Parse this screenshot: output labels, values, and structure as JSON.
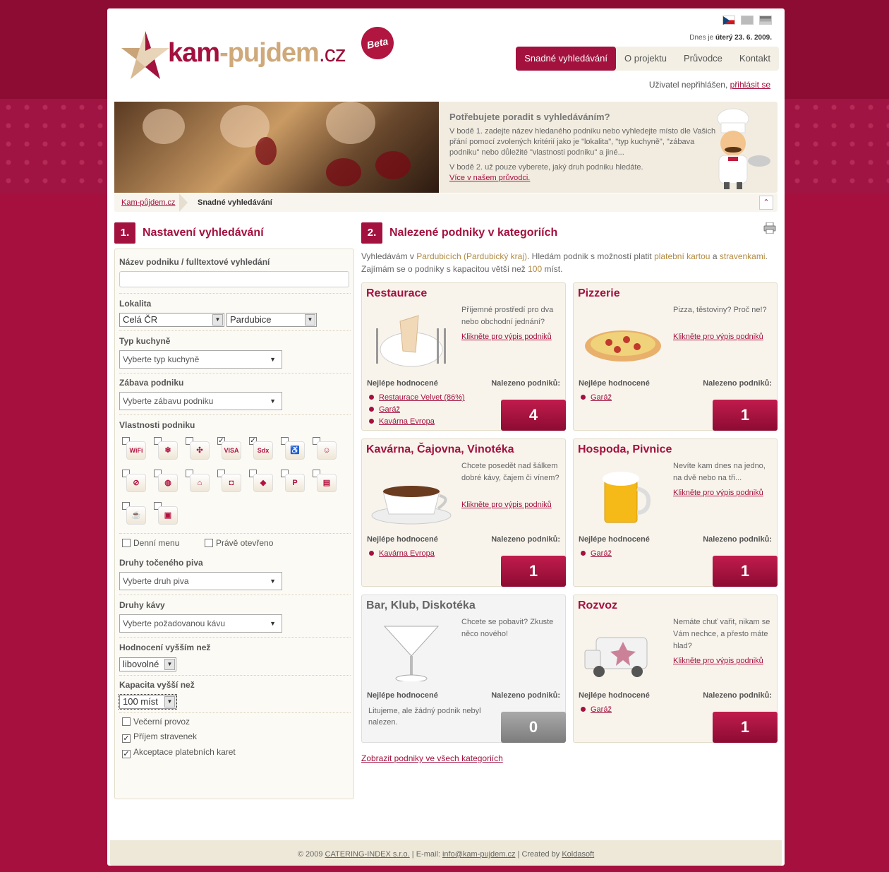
{
  "flags": [
    "cz-flag-icon",
    "en-flag-icon",
    "de-flag-icon"
  ],
  "header": {
    "logo_kam": "kam",
    "logo_dash": "-",
    "logo_pujdem": "pujdem",
    "logo_tld": ".cz",
    "beta": "Beta",
    "date_prefix": "Dnes je",
    "date_value": "úterý 23. 6. 2009."
  },
  "nav": [
    "Snadné vyhledávání",
    "O projektu",
    "Průvodce",
    "Kontakt"
  ],
  "login": {
    "text": "Uživatel nepřihlášen,",
    "link": "přihlásit se"
  },
  "banner": {
    "title": "Potřebujete poradit s vyhledáváním?",
    "p1": "V bodě 1. zadejte název hledaného podniku nebo vyhledejte místo dle Vašich přání pomocí zvolených kritérií jako je \"lokalita\", \"typ kuchyně\", \"zábava podniku\" nebo důležité \"vlastnosti podniku\" a jiné...",
    "p2": "V bodě 2. už pouze vyberete, jaký druh podniku hledáte.",
    "link": "Více v našem průvodci."
  },
  "breadcrumb": [
    "Kam-půjdem.cz",
    "Snadné vyhledávání"
  ],
  "left": {
    "num": "1.",
    "title": "Nastavení vyhledávání",
    "name_label": "Název podniku / fulltextové vyhledání",
    "location_label": "Lokalita",
    "location_region": "Celá ČR",
    "location_city": "Pardubice",
    "cuisine_label": "Typ kuchyně",
    "cuisine_value": "Vyberte typ kuchyně",
    "fun_label": "Zábava podniku",
    "fun_value": "Vyberte zábavu podniku",
    "props_label": "Vlastnosti podniku",
    "props": [
      {
        "icon": "wifi-icon",
        "checked": false,
        "glyph": "WiFi"
      },
      {
        "icon": "air-conditioning-icon",
        "checked": false,
        "glyph": "❄"
      },
      {
        "icon": "fan-icon",
        "checked": false,
        "glyph": "✣"
      },
      {
        "icon": "visa-card-icon",
        "checked": true,
        "glyph": "VISA"
      },
      {
        "icon": "sodexo-voucher-icon",
        "checked": true,
        "glyph": "Sdx"
      },
      {
        "icon": "wheelchair-icon",
        "checked": false,
        "glyph": "♿"
      },
      {
        "icon": "baby-icon",
        "checked": false,
        "glyph": "☺"
      },
      {
        "icon": "no-smoking-icon",
        "checked": false,
        "glyph": "⊘"
      },
      {
        "icon": "smoking-area-icon",
        "checked": false,
        "glyph": "◍"
      },
      {
        "icon": "terrace-icon",
        "checked": false,
        "glyph": "⌂"
      },
      {
        "icon": "takeaway-icon",
        "checked": false,
        "glyph": "◘"
      },
      {
        "icon": "delivery-icon",
        "checked": false,
        "glyph": "◆"
      },
      {
        "icon": "parking-icon",
        "checked": false,
        "glyph": "P"
      },
      {
        "icon": "meeting-room-icon",
        "checked": false,
        "glyph": "▤"
      },
      {
        "icon": "coffee-icon",
        "checked": false,
        "glyph": "☕"
      },
      {
        "icon": "cinema-icon",
        "checked": false,
        "glyph": "▣"
      }
    ],
    "daily_menu": "Denní menu",
    "open_now": "Právě otevřeno",
    "beer_label": "Druhy točeného piva",
    "beer_value": "Vyberte druh piva",
    "coffee_label": "Druhy kávy",
    "coffee_value": "Vyberte požadovanou kávu",
    "rating_label": "Hodnocení vyšším než",
    "rating_value": "libovolné",
    "capacity_label": "Kapacita vyšší než",
    "capacity_value": "100 míst",
    "evening": "Večerní provoz",
    "vouchers": "Příjem stravenek",
    "cards": "Akceptace platebních karet"
  },
  "right": {
    "num": "2.",
    "title": "Nalezené podniky v kategoriích",
    "intro_a": "Vyhledávám v ",
    "intro_city": "Pardubicích (Pardubický kraj)",
    "intro_b": ". Hledám podnik s možností platit ",
    "intro_card": "platební kartou",
    "intro_c": " a ",
    "intro_voucher": "stravenkami",
    "intro_d": ".",
    "intro_e": "Zajímám se o podniky s kapacitou větší než ",
    "intro_cap": "100",
    "intro_f": " míst.",
    "best_label": "Nejlépe hodnocené",
    "found_label": "Nalezeno podniků:",
    "more_link": "Klikněte pro výpis podniků",
    "all_link": "Zobrazit podniky ve všech kategoriích"
  },
  "categories": [
    {
      "title": "Restaurace",
      "desc": "Příjemné prostředí pro dva nebo obchodní jednání?",
      "count": "4",
      "best": [
        "Restaurace Velvet (86%)",
        "Garáž",
        "Kavárna Evropa"
      ],
      "icon": "restaurant-plate-icon"
    },
    {
      "title": "Pizzerie",
      "desc": "Pizza, těstoviny? Proč ne!?",
      "count": "1",
      "best": [
        "Garáž"
      ],
      "icon": "pizza-icon"
    },
    {
      "title": "Kavárna, Čajovna, Vinotéka",
      "desc": "Chcete posedět nad šálkem dobré kávy, čajem či vínem?",
      "count": "1",
      "best": [
        "Kavárna Evropa"
      ],
      "icon": "coffee-cup-icon"
    },
    {
      "title": "Hospoda, Pivnice",
      "desc": "Nevíte kam dnes na jedno, na dvě nebo na tři...",
      "count": "1",
      "best": [
        "Garáž"
      ],
      "icon": "beer-mug-icon"
    },
    {
      "title": "Bar, Klub, Diskotéka",
      "desc": "Chcete se pobavit? Zkuste něco nového!",
      "count": "0",
      "best": [],
      "none": "Litujeme, ale žádný podnik nebyl nalezen.",
      "icon": "cocktail-glass-icon"
    },
    {
      "title": "Rozvoz",
      "desc": "Nemáte chuť vařit, nikam se Vám nechce, a přesto máte hlad?",
      "count": "1",
      "best": [
        "Garáž"
      ],
      "icon": "delivery-van-icon"
    }
  ],
  "footer": {
    "a": "© 2009 ",
    "company": "CATERING-INDEX s.r.o.",
    "b": " | E-mail: ",
    "email": "info@kam-pujdem.cz",
    "c": " | Created by ",
    "creator": "Koldasoft"
  }
}
